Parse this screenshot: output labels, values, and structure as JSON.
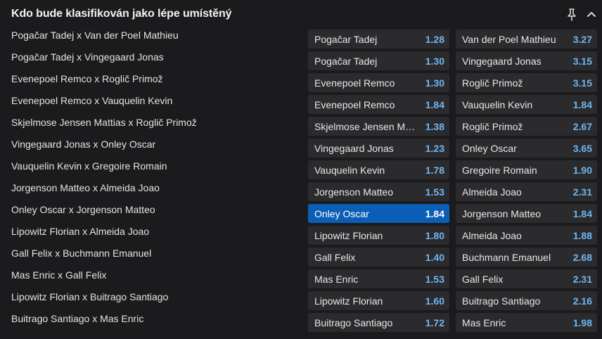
{
  "header": {
    "title": "Kdo bude klasifikován jako lépe umístěný",
    "pin_icon": "pin-icon",
    "collapse_icon": "chevron-up-icon"
  },
  "colors": {
    "background": "#1b1b1d",
    "button": "#2b2b2e",
    "selected": "#0a5eb5",
    "price": "#6fb6f0"
  },
  "markets": [
    {
      "match": "Pogačar Tadej x Van der Poel Mathieu",
      "rider1": "Pogačar Tadej",
      "odd1": "1.28",
      "rider2": "Van der Poel Mathieu",
      "odd2": "3.27"
    },
    {
      "match": "Pogačar Tadej x Vingegaard Jonas",
      "rider1": "Pogačar Tadej",
      "odd1": "1.30",
      "rider2": "Vingegaard Jonas",
      "odd2": "3.15"
    },
    {
      "match": "Evenepoel Remco x Roglič Primož",
      "rider1": "Evenepoel Remco",
      "odd1": "1.30",
      "rider2": "Roglič Primož",
      "odd2": "3.15"
    },
    {
      "match": "Evenepoel Remco x Vauquelin Kevin",
      "rider1": "Evenepoel Remco",
      "odd1": "1.84",
      "rider2": "Vauquelin Kevin",
      "odd2": "1.84"
    },
    {
      "match": "Skjelmose Jensen Mattias x Roglič Primož",
      "rider1": "Skjelmose Jensen Mattias",
      "odd1": "1.38",
      "rider2": "Roglič Primož",
      "odd2": "2.67"
    },
    {
      "match": "Vingegaard Jonas x Onley Oscar",
      "rider1": "Vingegaard Jonas",
      "odd1": "1.23",
      "rider2": "Onley Oscar",
      "odd2": "3.65"
    },
    {
      "match": "Vauquelin Kevin x Gregoire Romain",
      "rider1": "Vauquelin Kevin",
      "odd1": "1.78",
      "rider2": "Gregoire Romain",
      "odd2": "1.90"
    },
    {
      "match": "Jorgenson Matteo x Almeida Joao",
      "rider1": "Jorgenson Matteo",
      "odd1": "1.53",
      "rider2": "Almeida Joao",
      "odd2": "2.31"
    },
    {
      "match": "Onley Oscar x Jorgenson Matteo",
      "rider1": "Onley Oscar",
      "odd1": "1.84",
      "rider2": "Jorgenson Matteo",
      "odd2": "1.84"
    },
    {
      "match": "Lipowitz Florian x Almeida Joao",
      "rider1": "Lipowitz Florian",
      "odd1": "1.80",
      "rider2": "Almeida Joao",
      "odd2": "1.88"
    },
    {
      "match": "Gall Felix x Buchmann Emanuel",
      "rider1": "Gall Felix",
      "odd1": "1.40",
      "rider2": "Buchmann Emanuel",
      "odd2": "2.68"
    },
    {
      "match": "Mas Enric x Gall Felix",
      "rider1": "Mas Enric",
      "odd1": "1.53",
      "rider2": "Gall Felix",
      "odd2": "2.31"
    },
    {
      "match": "Lipowitz Florian x Buitrago Santiago",
      "rider1": "Lipowitz Florian",
      "odd1": "1.60",
      "rider2": "Buitrago Santiago",
      "odd2": "2.16"
    },
    {
      "match": "Buitrago Santiago x Mas Enric",
      "rider1": "Buitrago Santiago",
      "odd1": "1.72",
      "rider2": "Mas Enric",
      "odd2": "1.98"
    }
  ]
}
